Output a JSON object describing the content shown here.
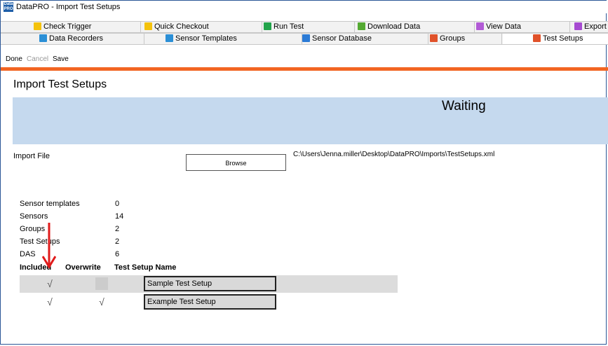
{
  "window": {
    "title": "DataPRO - Import Test Setups",
    "icon_label": "Data PRO"
  },
  "tabs_row1": [
    {
      "label": "Check Trigger",
      "color": "#f4c20d"
    },
    {
      "label": "Quick Checkout",
      "color": "#f4c20d"
    },
    {
      "label": "Run Test",
      "color": "#22a34a"
    },
    {
      "label": "Download Data",
      "color": "#55aa33"
    },
    {
      "label": "View Data",
      "color": "#b25bd6"
    },
    {
      "label": "Export",
      "color": "#a64bd1"
    }
  ],
  "tabs_row2": [
    {
      "label": "Data Recorders",
      "color": "#2b8fd6"
    },
    {
      "label": "Sensor Templates",
      "color": "#2b8fd6"
    },
    {
      "label": "Sensor Database",
      "color": "#2b7bd6"
    },
    {
      "label": "Groups",
      "color": "#e0522a"
    },
    {
      "label": "Test Setups",
      "color": "#e0522a",
      "active": true
    }
  ],
  "toolbar": {
    "done": "Done",
    "cancel": "Cancel",
    "save": "Save"
  },
  "page_title": "Import Test Setups",
  "status": "Waiting",
  "import": {
    "label": "Import File",
    "browse": "Browse",
    "path": "C:\\Users\\Jenna.miller\\Desktop\\DataPRO\\Imports\\TestSetups.xml"
  },
  "counts": [
    {
      "label": "Sensor templates",
      "value": "0"
    },
    {
      "label": "Sensors",
      "value": "14"
    },
    {
      "label": "Groups",
      "value": "2"
    },
    {
      "label": "Test Setups",
      "value": "2"
    },
    {
      "label": "DAS",
      "value": "6"
    }
  ],
  "table": {
    "headers": {
      "included": "Included",
      "overwrite": "Overwrite",
      "name": "Test Setup Name"
    },
    "rows": [
      {
        "included": true,
        "overwrite": false,
        "name": "Sample Test Setup"
      },
      {
        "included": true,
        "overwrite": true,
        "name": "Example Test Setup"
      }
    ]
  },
  "check_glyph": "√",
  "accent_color": "#f26522",
  "banner_color": "#c5d9ee"
}
